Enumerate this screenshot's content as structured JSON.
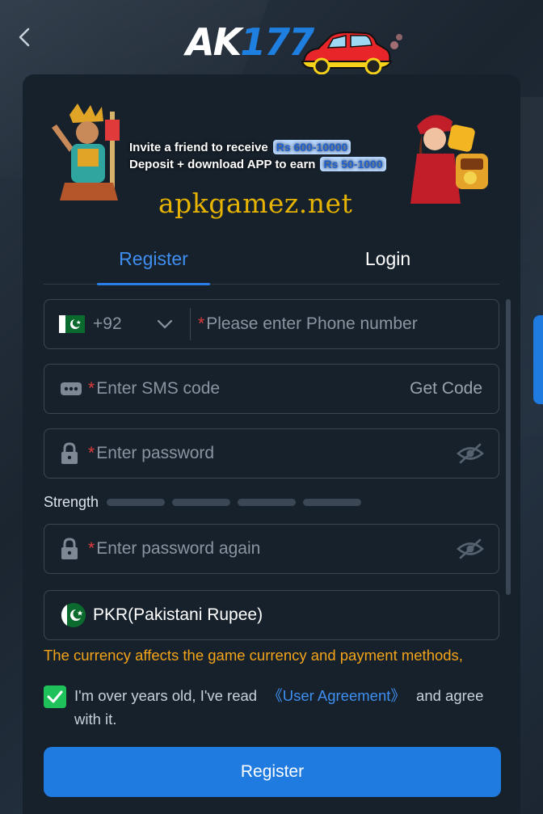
{
  "header": {
    "logo_main": "AK",
    "logo_num": "177"
  },
  "banner": {
    "line1": "Invite a friend to receive",
    "line1_highlight": "Rs 600-10000",
    "line2": "Deposit + download APP to earn",
    "line2_highlight": "Rs 50-1000"
  },
  "watermark": "apkgamez.net",
  "tabs": {
    "register": "Register",
    "login": "Login",
    "active": "register"
  },
  "form": {
    "phone": {
      "country_code": "+92",
      "placeholder": "Please enter Phone number"
    },
    "sms": {
      "placeholder": "Enter SMS code",
      "get_code": "Get Code"
    },
    "password": {
      "placeholder": "Enter password"
    },
    "strength_label": "Strength",
    "password_again": {
      "placeholder": "Enter password again"
    },
    "currency": {
      "value": "PKR(Pakistani Rupee)"
    },
    "note": "The currency affects the game currency and payment methods,"
  },
  "agreement": {
    "checked": true,
    "prefix": "I'm over years old, I've read",
    "link": "《User Agreement》",
    "suffix": "and agree with it."
  },
  "submit_label": "Register",
  "colors": {
    "accent": "#1f7be0",
    "warning": "#f3a419",
    "required": "#e23b3b",
    "check": "#1fc15a"
  }
}
